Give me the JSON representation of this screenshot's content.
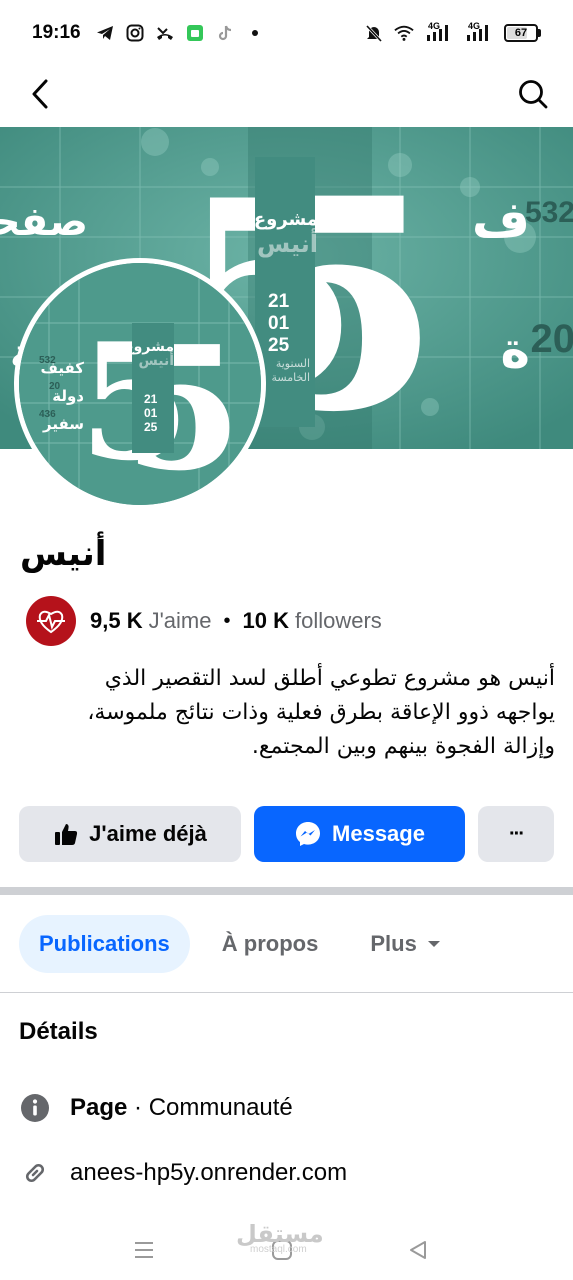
{
  "status_bar": {
    "time": "19:16",
    "left_icons": [
      "telegram-icon",
      "instagram-icon",
      "missed-call-icon",
      "android-app-icon",
      "tiktok-icon",
      "dot-icon"
    ],
    "right_icons": [
      "mute-icon",
      "wifi-icon",
      "signal-4g-icon",
      "signal-4g-icon"
    ],
    "net_label_1": "4G",
    "net_label_2": "4G",
    "battery_level": "67"
  },
  "nav": {
    "back_icon": "chevron-left-icon",
    "search_icon": "search-icon"
  },
  "cover": {
    "title_word": "مشروع",
    "title_name": "أنيس",
    "digit": "5",
    "date_lines": [
      "21",
      "01",
      "25"
    ],
    "caption_lines": [
      "السنوية",
      "الخامسة"
    ],
    "left_words": [
      "صفحة",
      "بة"
    ],
    "right_numbers": [
      "532",
      "20"
    ],
    "right_words": [
      "ف",
      "ة"
    ]
  },
  "profile": {
    "name": "أنيس",
    "stats": {
      "likes_value": "9,5 K",
      "likes_label": "J'aime",
      "separator": "•",
      "followers_value": "10 K",
      "followers_label": "followers"
    },
    "bio_lines": [
      "أنيس هو مشروع تطوعي أطلق لسد التقصير الذي",
      "يواجهه ذوو الإعاقة بطرق فعلية وذات نتائج ملموسة،",
      "وإزالة الفجوة بينهم وبين المجتمع."
    ],
    "profile_pic": {
      "stats_words": [
        "كفيف",
        "دولة",
        "سفير"
      ],
      "stats_numbers": [
        "532",
        "20",
        "436"
      ]
    }
  },
  "actions": {
    "like_label": "J'aime déjà",
    "message_label": "Message",
    "more_label": "···"
  },
  "tabs": [
    {
      "label": "Publications"
    },
    {
      "label": "À propos"
    },
    {
      "label": "Plus"
    }
  ],
  "details": {
    "title": "Détails",
    "type_strong": "Page",
    "type_rest": " · Communauté",
    "link": "anees-hp5y.onrender.com"
  },
  "watermark": {
    "text": "مستقل",
    "sub": "mostaql.com"
  },
  "colors": {
    "accent": "#0866ff",
    "cover_teal": "#4e9a8c",
    "avatar_red": "#b5121b"
  }
}
